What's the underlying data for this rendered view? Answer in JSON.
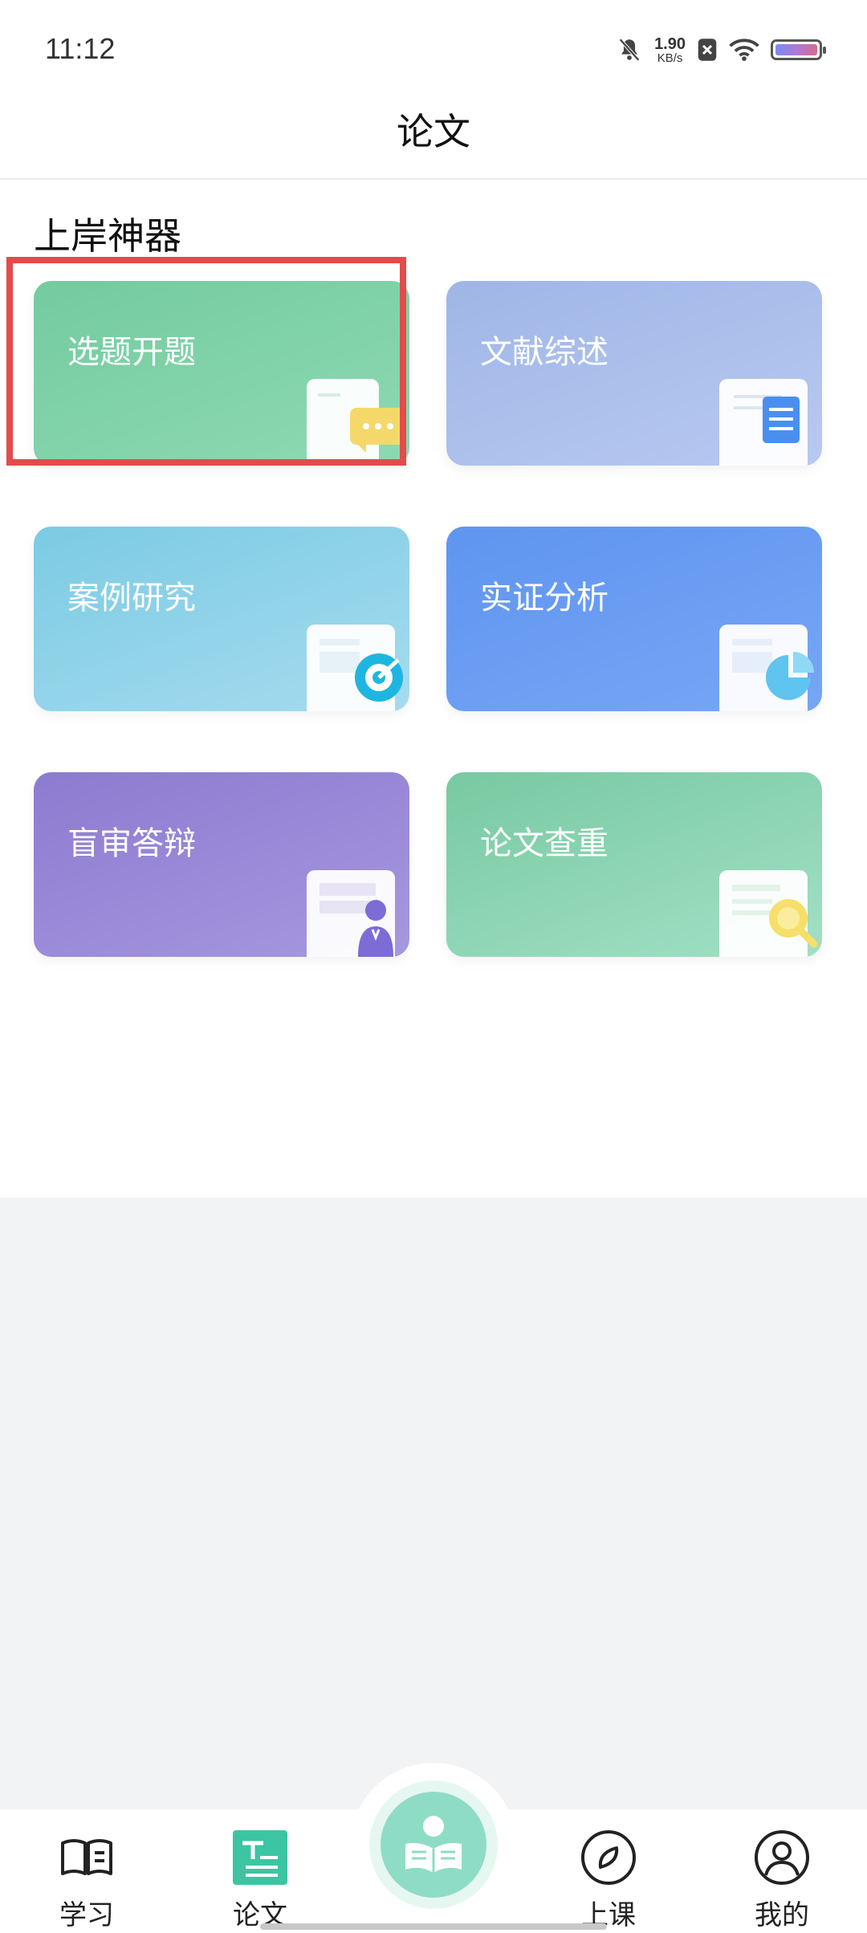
{
  "status_bar": {
    "time": "11:12",
    "net_speed_value": "1.90",
    "net_speed_unit": "KB/s"
  },
  "header": {
    "title": "论文"
  },
  "section": {
    "title": "上岸神器"
  },
  "cards": [
    {
      "label": "选题开题",
      "color": "#7dcfa6"
    },
    {
      "label": "文献综述",
      "color": "#a9bfeb"
    },
    {
      "label": "案例研究",
      "color": "#8fd3e9"
    },
    {
      "label": "实证分析",
      "color": "#679cf2"
    },
    {
      "label": "盲审答辩",
      "color": "#9887d6"
    },
    {
      "label": "论文查重",
      "color": "#8cd5b2"
    }
  ],
  "bottom_nav": {
    "items": [
      {
        "label": "学习",
        "icon": "open-book-icon"
      },
      {
        "label": "论文",
        "icon": "document-lines-icon",
        "active": true
      },
      {
        "label": "上课",
        "icon": "compass-icon"
      },
      {
        "label": "我的",
        "icon": "user-circle-icon"
      }
    ],
    "center_icon": "reading-person-icon",
    "accent_color": "#3cc5a2"
  }
}
